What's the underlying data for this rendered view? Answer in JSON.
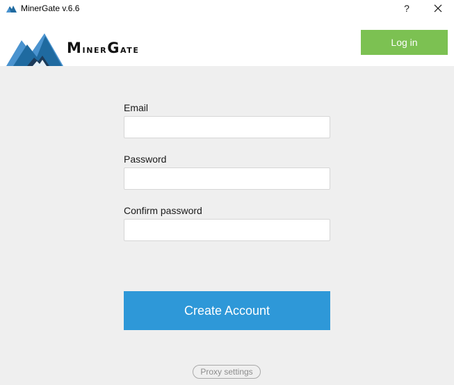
{
  "window": {
    "title": "MinerGate v.6.6",
    "help_label": "?"
  },
  "header": {
    "brand_first_cap": "M",
    "brand_first_rest": "iner",
    "brand_second_cap": "G",
    "brand_second_rest": "ate",
    "login_label": "Log in"
  },
  "form": {
    "email": {
      "label": "Email",
      "value": "",
      "placeholder": ""
    },
    "password": {
      "label": "Password",
      "value": "",
      "placeholder": ""
    },
    "confirm_password": {
      "label": "Confirm password",
      "value": "",
      "placeholder": ""
    },
    "submit_label": "Create Account"
  },
  "footer": {
    "proxy_label": "Proxy settings"
  },
  "colors": {
    "background": "#efefef",
    "login_green": "#7cc152",
    "create_blue": "#2e98d8",
    "logo_dark_blue": "#1f6aa0",
    "logo_light_blue": "#4a93cf",
    "logo_navy": "#1d3b5a"
  },
  "icons": {
    "app_icon": "minergate-logo-icon",
    "logo": "minergate-mountain-logo",
    "close": "close-icon"
  }
}
